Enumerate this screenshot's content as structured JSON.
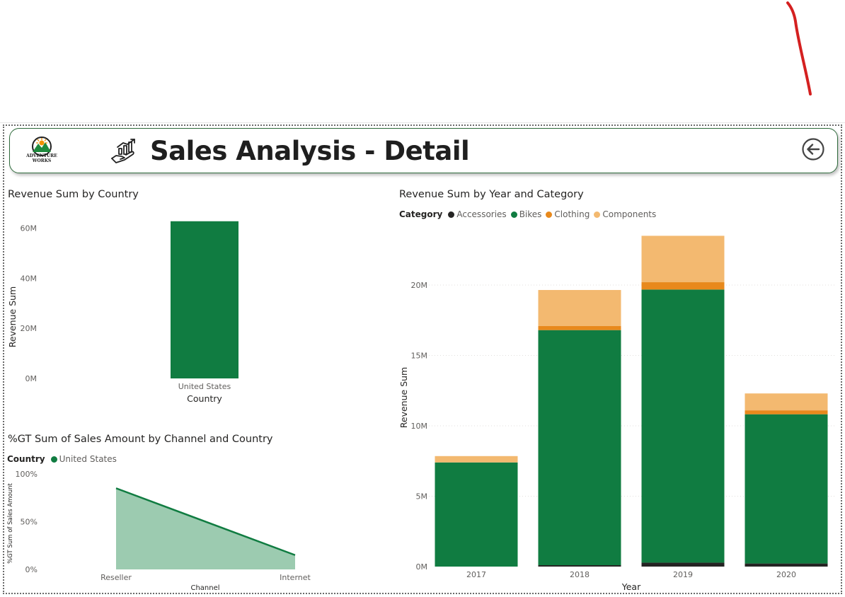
{
  "page": {
    "title": "Sales Analysis - Detail",
    "logo_text_line1": "ADVENTURE",
    "logo_text_line2": "WORKS",
    "back_icon": "back-arrow-circle-icon",
    "title_icon": "growth-chart-hand-icon"
  },
  "colors": {
    "accessories": "#252423",
    "bikes": "#107c41",
    "clothing": "#e8891c",
    "components": "#f3b970",
    "area_fill": "#9ccbb0",
    "area_line": "#107c41"
  },
  "chart_data": [
    {
      "id": "revenue-by-country",
      "type": "bar",
      "title": "Revenue Sum by Country",
      "xlabel": "Country",
      "ylabel": "Revenue Sum",
      "categories": [
        "United States"
      ],
      "values": [
        62800000
      ],
      "ylim": [
        0,
        65000000
      ],
      "yticks": [
        0,
        20000000,
        40000000,
        60000000
      ],
      "ytick_labels": [
        "0M",
        "20M",
        "40M",
        "60M"
      ],
      "grid": false
    },
    {
      "id": "gt-sales-by-channel",
      "type": "area",
      "title": "%GT Sum of Sales Amount by Channel and Country",
      "xlabel": "Channel",
      "ylabel": "%GT Sum of Sales Amount",
      "legend_title": "Country",
      "categories": [
        "Reseller",
        "Internet"
      ],
      "series": [
        {
          "name": "United States",
          "values": [
            0.85,
            0.15
          ]
        }
      ],
      "ylim": [
        0,
        1
      ],
      "yticks": [
        0,
        0.5,
        1
      ],
      "ytick_labels": [
        "0%",
        "50%",
        "100%"
      ],
      "legend_position": "top-left"
    },
    {
      "id": "revenue-by-year-category",
      "type": "bar",
      "stacked": true,
      "title": "Revenue Sum by Year and Category",
      "xlabel": "Year",
      "ylabel": "Revenue Sum",
      "legend_title": "Category",
      "legend_position": "top-left",
      "categories": [
        "2017",
        "2018",
        "2019",
        "2020"
      ],
      "series": [
        {
          "name": "Accessories",
          "values": [
            0,
            100000,
            280000,
            220000
          ]
        },
        {
          "name": "Bikes",
          "values": [
            7400000,
            16700000,
            19400000,
            10600000
          ]
        },
        {
          "name": "Clothing",
          "values": [
            0,
            300000,
            520000,
            280000
          ]
        },
        {
          "name": "Components",
          "values": [
            450000,
            2550000,
            3300000,
            1200000
          ]
        }
      ],
      "ylim": [
        0,
        23000000
      ],
      "yticks": [
        0,
        5000000,
        10000000,
        15000000,
        20000000
      ],
      "ytick_labels": [
        "0M",
        "5M",
        "10M",
        "15M",
        "20M"
      ],
      "grid": true
    }
  ]
}
